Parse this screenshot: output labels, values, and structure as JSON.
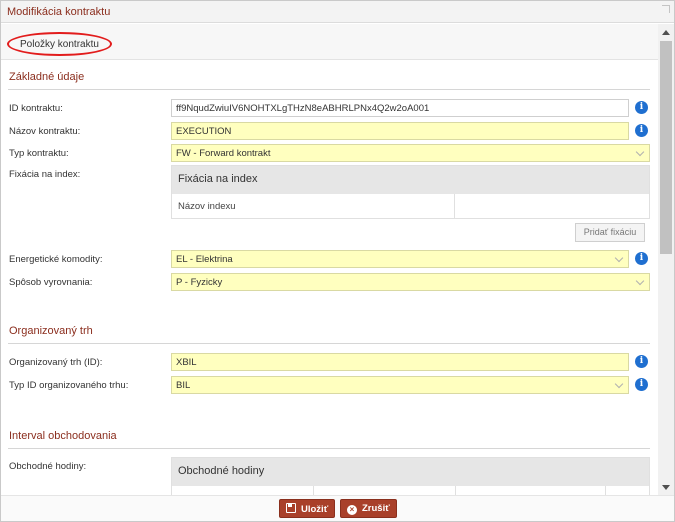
{
  "dialog": {
    "title": "Modifikácia kontraktu"
  },
  "tabs": {
    "items_label": "Položky kontraktu"
  },
  "basic": {
    "title": "Základné údaje",
    "contract_id_label": "ID kontraktu:",
    "contract_id_value": "ff9NqudZwiuIV6NOHTXLgTHzN8eABHRLPNx4Q2w2oA001",
    "contract_name_label": "Názov kontraktu:",
    "contract_name_value": "EXECUTION",
    "contract_type_label": "Typ kontraktu:",
    "contract_type_value": "FW - Forward kontrakt",
    "index_label": "Fixácia na index:",
    "index_grid_title": "Fixácia na index",
    "index_grid_column": "Názov indexu",
    "add_fixation_label": "Pridať fixáciu",
    "commodities_label": "Energetické komodity:",
    "commodities_value": "EL - Elektrina",
    "settlement_label": "Spôsob vyrovnania:",
    "settlement_value": "P - Fyzicky"
  },
  "market": {
    "title": "Organizovaný trh",
    "market_id_label": "Organizovaný trh (ID):",
    "market_id_value": "XBIL",
    "market_type_label": "Typ ID organizovaného trhu:",
    "market_type_value": "BIL"
  },
  "interval": {
    "title": "Interval obchodovania",
    "hours_label": "Obchodné hodiny:",
    "hours_grid_title": "Obchodné hodiny"
  },
  "footer": {
    "save_label": "Uložiť",
    "cancel_label": "Zrušiť"
  },
  "icons": {
    "info": "i"
  },
  "colors": {
    "accent": "#8b2e1e",
    "button": "#a9402a",
    "required_field": "#ffffbf",
    "info_icon": "#1f6fd0",
    "highlight_circle": "#e21c1c"
  }
}
